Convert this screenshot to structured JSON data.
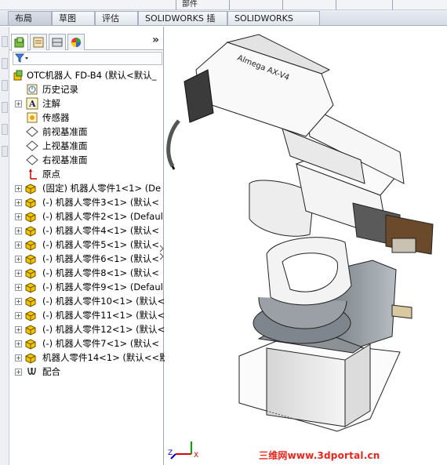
{
  "top_fragment": "部件",
  "tabs": [
    "布局",
    "草图",
    "评估",
    "SOLIDWORKS 插件",
    "SOLIDWORKS MBD"
  ],
  "panel": {
    "expand_symbol": "»",
    "tree": [
      {
        "label": "OTC机器人 FD-B4  (默认<默认_",
        "icon": "assembly-icon",
        "expander": ""
      },
      {
        "label": "历史记录",
        "icon": "history-icon",
        "expander": ""
      },
      {
        "label": "注解",
        "icon": "annotation-icon",
        "expander": "+"
      },
      {
        "label": "传感器",
        "icon": "sensor-icon",
        "expander": ""
      },
      {
        "label": "前视基准面",
        "icon": "plane-icon",
        "expander": ""
      },
      {
        "label": "上视基准面",
        "icon": "plane-icon",
        "expander": ""
      },
      {
        "label": "右视基准面",
        "icon": "plane-icon",
        "expander": ""
      },
      {
        "label": "原点",
        "icon": "origin-icon",
        "expander": ""
      },
      {
        "label": "(固定) 机器人零件1<1> (De",
        "icon": "part-icon",
        "expander": "+"
      },
      {
        "label": "(-) 机器人零件3<1> (默认<",
        "icon": "part-icon",
        "expander": "+"
      },
      {
        "label": "(-) 机器人零件2<1> (Defaul",
        "icon": "part-icon",
        "expander": "+"
      },
      {
        "label": "(-) 机器人零件4<1> (默认<",
        "icon": "part-icon",
        "expander": "+"
      },
      {
        "label": "(-) 机器人零件5<1> (默认<",
        "icon": "part-icon",
        "expander": "+"
      },
      {
        "label": "(-) 机器人零件6<1> (默认<",
        "icon": "part-icon",
        "expander": "+"
      },
      {
        "label": "(-) 机器人零件8<1> (默认<",
        "icon": "part-icon",
        "expander": "+"
      },
      {
        "label": "(-) 机器人零件9<1> (Defaul",
        "icon": "part-icon",
        "expander": "+"
      },
      {
        "label": "(-) 机器人零件10<1> (默认<",
        "icon": "part-icon",
        "expander": "+"
      },
      {
        "label": "(-) 机器人零件11<1> (默认<",
        "icon": "part-icon",
        "expander": "+"
      },
      {
        "label": "(-) 机器人零件12<1> (默认<",
        "icon": "part-icon",
        "expander": "+"
      },
      {
        "label": "(-) 机器人零件7<1> (默认<",
        "icon": "part-icon",
        "expander": "+"
      },
      {
        "label": "机器人零件14<1> (默认<<默",
        "icon": "part-icon",
        "expander": "+"
      },
      {
        "label": "配合",
        "icon": "mates-icon",
        "expander": "+"
      }
    ]
  },
  "model_label": "Almega AX-V4",
  "triad": {
    "z": "Z",
    "x": "X"
  },
  "watermark": "三维网www.3dportal.cn",
  "colors": {
    "part_yellow": "#f2c400",
    "tab_border": "#a7afbd",
    "watermark_red": "#e8261c"
  }
}
